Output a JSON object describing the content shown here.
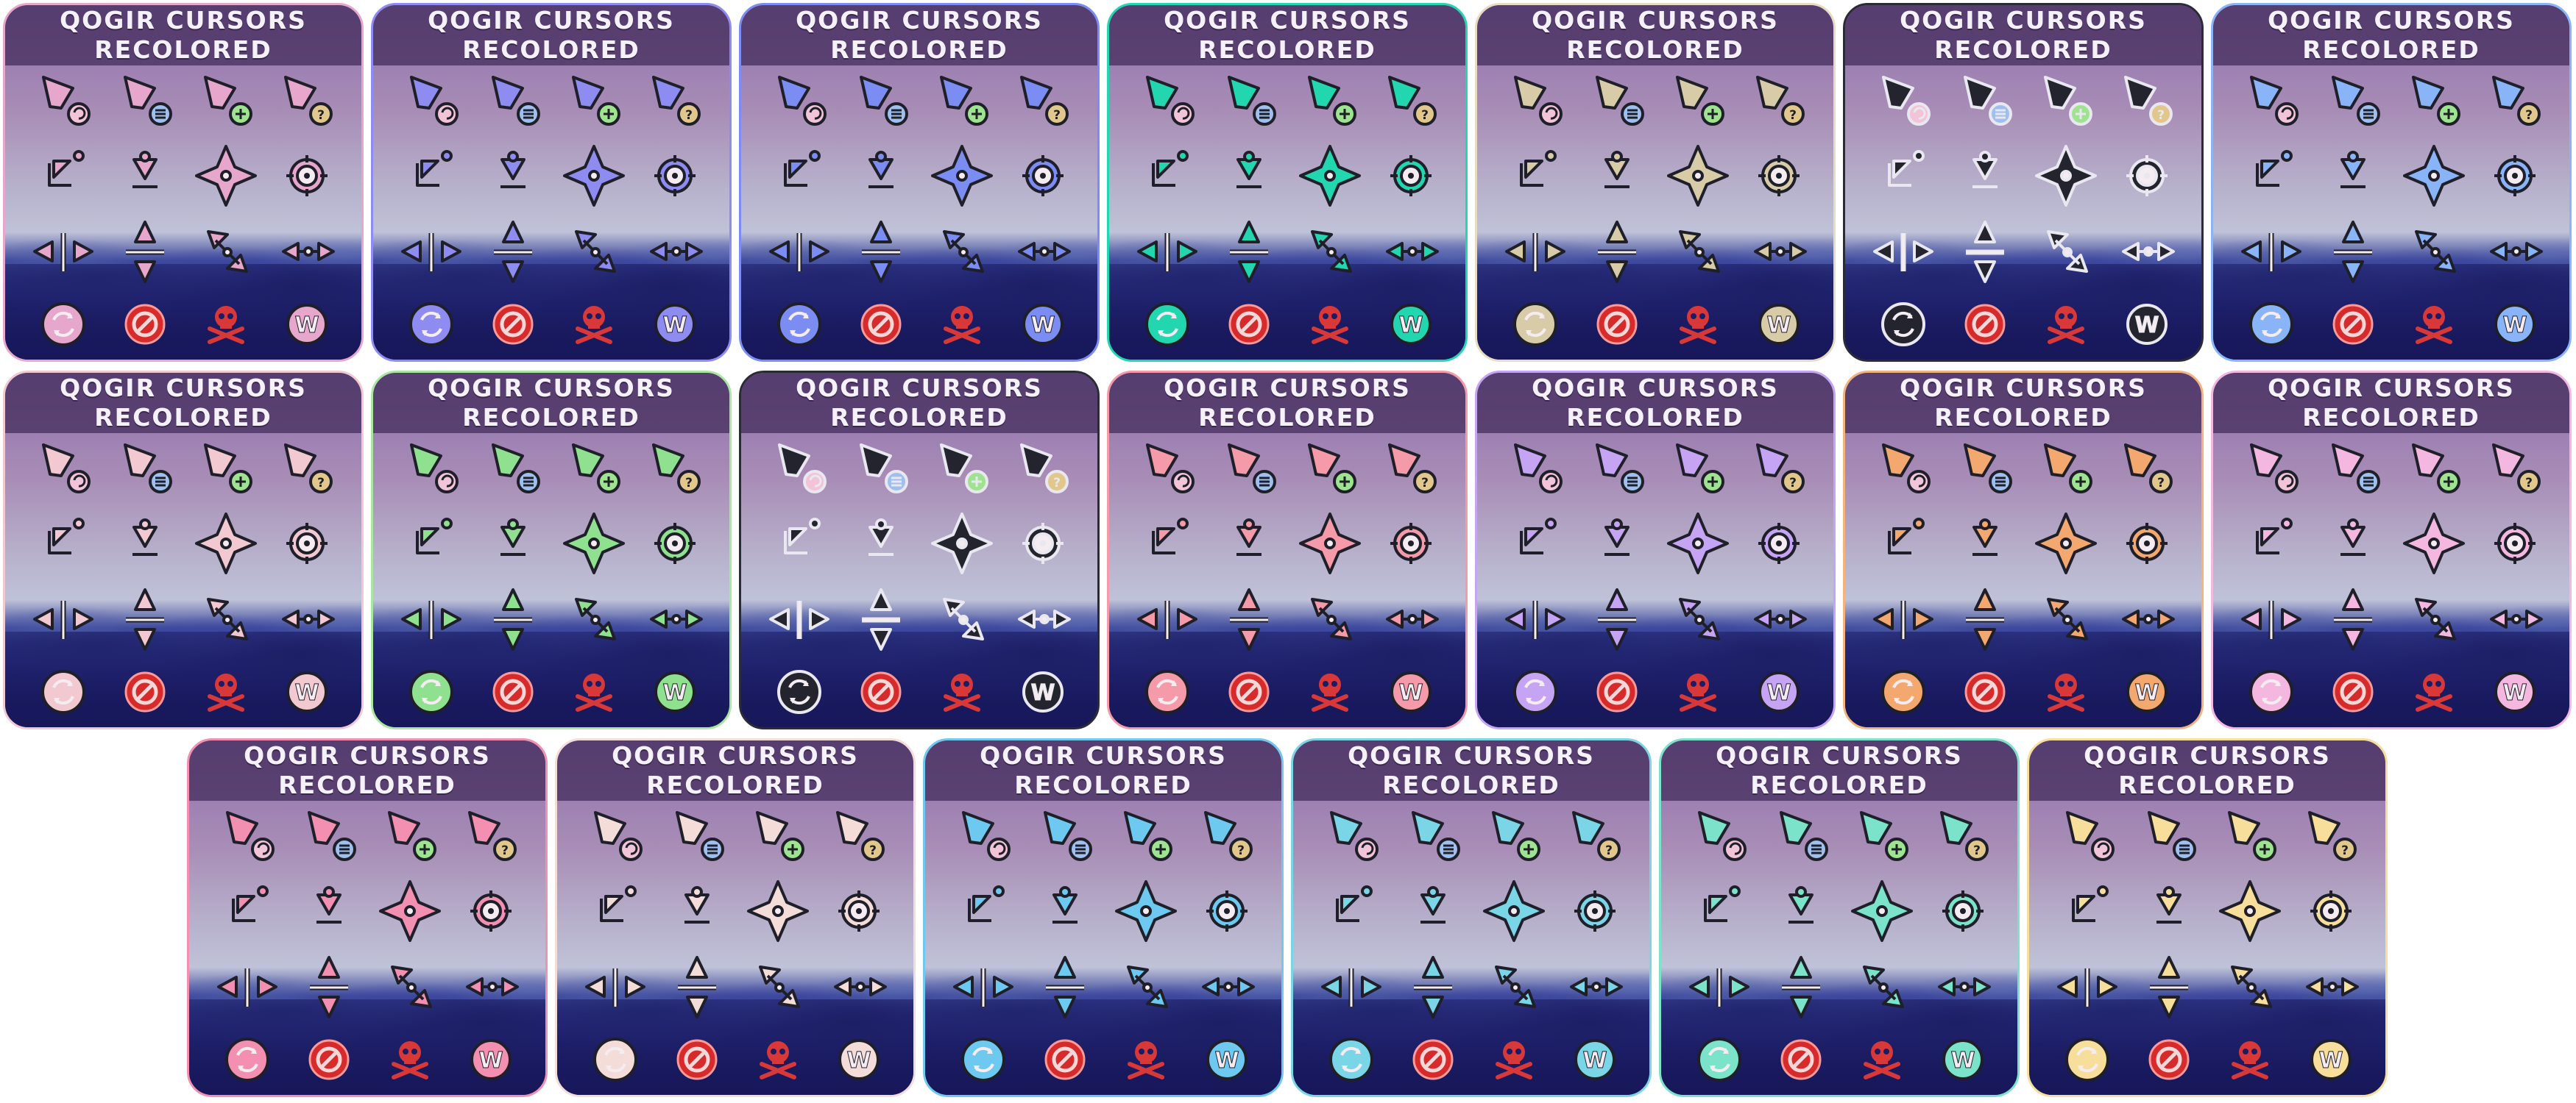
{
  "title_line1": "QOGIR CURSORS",
  "title_line2": "RECOLORED",
  "variants": [
    {
      "accent": "#e7a7cc",
      "border": "#e7a7cc"
    },
    {
      "accent": "#8e8cf0",
      "border": "#8e8cf0"
    },
    {
      "accent": "#7b8cf2",
      "border": "#7b8cf2"
    },
    {
      "accent": "#22d6b0",
      "border": "#22d6b0"
    },
    {
      "accent": "#d8cca8",
      "border": "#e8dcc0"
    },
    {
      "accent": "#23242e",
      "border": "#2a2b35"
    },
    {
      "accent": "#8ab4f8",
      "border": "#8ab4f8"
    },
    {
      "accent": "#f2c9d0",
      "border": "#f2c9d0"
    },
    {
      "accent": "#8fe08f",
      "border": "#a9e7a0"
    },
    {
      "accent": "#23242e",
      "border": "#2a2b35"
    },
    {
      "accent": "#f49aa8",
      "border": "#f49aa8"
    },
    {
      "accent": "#c4a4f3",
      "border": "#c4a4f3"
    },
    {
      "accent": "#f3a86f",
      "border": "#f3b37f"
    },
    {
      "accent": "#f4b8e0",
      "border": "#f4b8e0"
    },
    {
      "accent": "#f38fb0",
      "border": "#f38fb0"
    },
    {
      "accent": "#f4dcd8",
      "border": "#f4dcd8"
    },
    {
      "accent": "#6ec9f0",
      "border": "#6ec9f0"
    },
    {
      "accent": "#7ad6e6",
      "border": "#7ad6e6"
    },
    {
      "accent": "#7ae3c9",
      "border": "#7ae3c9"
    },
    {
      "accent": "#f7de9a",
      "border": "#f7de9a"
    }
  ]
}
